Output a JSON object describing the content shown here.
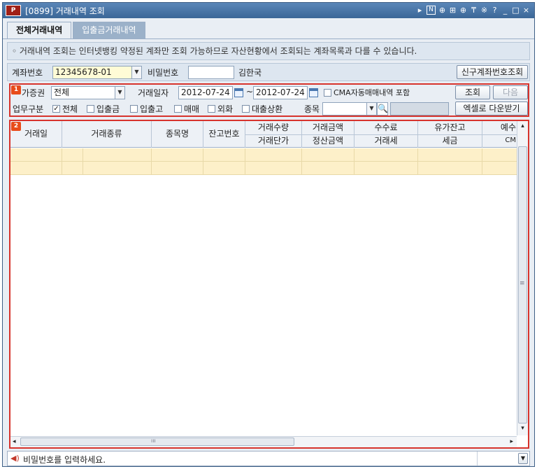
{
  "window": {
    "app_logo": "P",
    "title": "[0899] 거래내역 조회",
    "toolbar_icons": [
      "arrow-right-icon",
      "n-icon",
      "zoom-icon",
      "window-icon",
      "zoom-in-icon",
      "pin-icon",
      "settings-icon",
      "help-icon",
      "minimize-icon",
      "maximize-icon",
      "close-icon"
    ],
    "toolbar_glyphs": {
      "arrow": "▸",
      "n": "N",
      "zoom": "⊕",
      "win": "⊞",
      "zoom2": "⊕",
      "pin": "₸",
      "set": "※",
      "help": "?",
      "min": "_",
      "max": "□",
      "close": "×"
    }
  },
  "tabs": [
    {
      "label": "전체거래내역",
      "active": true
    },
    {
      "label": "입출금거래내역",
      "active": false
    }
  ],
  "notice": "◦ 거래내역 조회는 인터넷뱅킹 약정된 계좌만 조회 가능하므로 자산현황에서 조회되는 계좌목록과 다를 수 있습니다.",
  "account": {
    "account_label": "계좌번호",
    "account_value": "12345678-01",
    "password_label": "비밀번호",
    "password_value": "",
    "owner_name": "김한국",
    "new_account_button": "신구계좌번호조회"
  },
  "filters": {
    "badge": "1",
    "broker_label": "가증권",
    "broker_value": "전체",
    "date_label": "거래일자",
    "date_from": "2012-07-24",
    "date_sep": "~",
    "date_to": "2012-07-24",
    "cma_label": "CMA자동매매내역 포함",
    "search_button": "조회",
    "next_button": "다음",
    "biz_label": "업무구분",
    "checkbox_all": "전체",
    "checkbox_inout": "입출금",
    "checkbox_transfer": "입출고",
    "checkbox_trade": "매매",
    "checkbox_fx": "외화",
    "checkbox_loan": "대출상환",
    "stock_label": "종목",
    "excel_button": "엑셀로 다운받기"
  },
  "grid": {
    "badge": "2",
    "columns": [
      {
        "top": "거래일",
        "bottom": ""
      },
      {
        "top": "거래종류",
        "bottom": ""
      },
      {
        "top": "종목명",
        "bottom": ""
      },
      {
        "top": "잔고번호",
        "bottom": ""
      },
      {
        "top": "거래수량",
        "bottom": "거래단가"
      },
      {
        "top": "거래금액",
        "bottom": "정산금액"
      },
      {
        "top": "수수료",
        "bottom": "거래세"
      },
      {
        "top": "유가잔고",
        "bottom": "세금"
      },
      {
        "top": "예수",
        "bottom": "CM"
      }
    ],
    "scroll_labels": {
      "up": "▴",
      "down": "▾",
      "left": "◂",
      "right": "▸",
      "grip_h": "ııı",
      "grip_v": "≡"
    }
  },
  "status": {
    "message": "비밀번호를 입력하세요.",
    "icon": "speaker-icon"
  }
}
